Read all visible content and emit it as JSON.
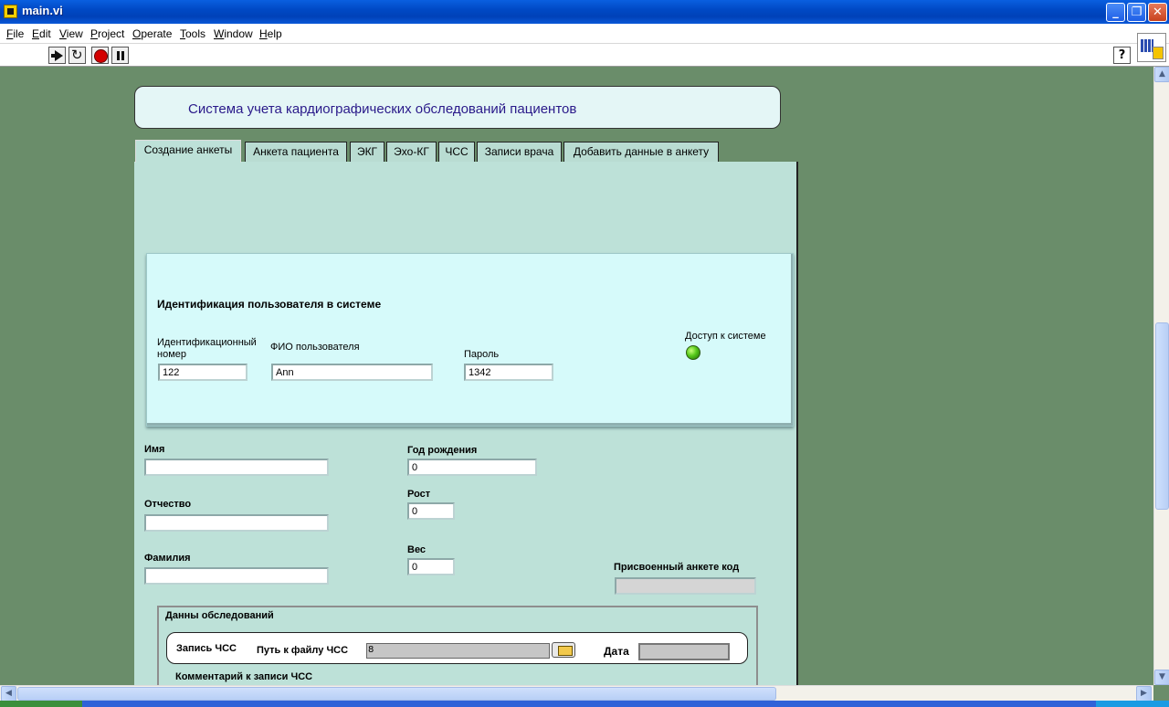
{
  "window": {
    "title": "main.vi",
    "buttons": [
      "_",
      "❐",
      "✕"
    ]
  },
  "menu": [
    "File",
    "Edit",
    "View",
    "Project",
    "Operate",
    "Tools",
    "Window",
    "Help"
  ],
  "toolbar": {
    "help_label": "?"
  },
  "header": {
    "title": "Система учета кардиографических обследований пациентов"
  },
  "tabs": [
    "Создание анкеты",
    "Анкета пациента",
    "ЭКГ",
    "Эхо-КГ",
    "ЧСС",
    "Записи врача",
    "Добавить данные в анкету"
  ],
  "identification": {
    "heading": "Идентификация пользователя в системе",
    "id_label": "Идентификационный номер",
    "id_value": "122",
    "name_label": "ФИО пользователя",
    "name_value": "Ann",
    "password_label": "Пароль",
    "password_value": "1342",
    "access_label": "Доступ к системе",
    "access_on": true,
    "led_color": "#55c81a"
  },
  "patient": {
    "first_name_label": "Имя",
    "first_name_value": "",
    "patronymic_label": "Отчество",
    "patronymic_value": "",
    "last_name_label": "Фамилия",
    "last_name_value": "",
    "birth_year_label": "Год рождения",
    "birth_year_value": "0",
    "height_label": "Рост",
    "height_value": "0",
    "weight_label": "Вес",
    "weight_value": "0",
    "code_label": "Присвоенный анкете код",
    "code_value": ""
  },
  "exams": {
    "heading": "Данны обследований",
    "hr_record_label": "Запись ЧСС",
    "hr_path_label": "Путь к файлу ЧСС",
    "path_glyph": "8",
    "date_label": "Дата",
    "comment_label": "Комментарий к записи ЧСС"
  },
  "colors": {
    "panel": "#bde1d8",
    "frame": "#6a8d6a",
    "title_text": "#2a1a8a"
  }
}
